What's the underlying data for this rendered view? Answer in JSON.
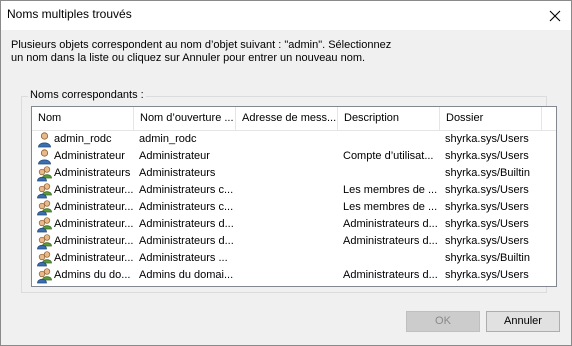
{
  "window": {
    "title": "Noms multiples trouvés"
  },
  "message": {
    "line1": "Plusieurs objets correspondent au nom d’objet suivant : \"admin\". Sélectionnez",
    "line2": "un nom dans la liste ou cliquez sur Annuler pour entrer un nouveau nom."
  },
  "matches": {
    "group_label": "Noms correspondants :",
    "columns": [
      "Nom",
      "Nom d’ouverture ...",
      "Adresse de mess...",
      "Description",
      "Dossier"
    ],
    "rows": [
      {
        "icon": "user-icon",
        "cells": [
          "admin_rodc",
          "admin_rodc",
          "",
          "",
          "shyrka.sys/Users"
        ]
      },
      {
        "icon": "user-icon",
        "cells": [
          "Administrateur",
          "Administrateur",
          "",
          "Compte d’utilisat...",
          "shyrka.sys/Users"
        ]
      },
      {
        "icon": "group-icon",
        "cells": [
          "Administrateurs",
          "Administrateurs",
          "",
          "",
          "shyrka.sys/Builtin"
        ]
      },
      {
        "icon": "group-icon",
        "cells": [
          "Administrateur...",
          "Administrateurs c...",
          "",
          "Les membres de ...",
          "shyrka.sys/Users"
        ]
      },
      {
        "icon": "group-icon",
        "cells": [
          "Administrateur...",
          "Administrateurs c...",
          "",
          "Les membres de ...",
          "shyrka.sys/Users"
        ]
      },
      {
        "icon": "group-icon",
        "cells": [
          "Administrateur...",
          "Administrateurs d...",
          "",
          "Administrateurs d...",
          "shyrka.sys/Users"
        ]
      },
      {
        "icon": "group-icon",
        "cells": [
          "Administrateur...",
          "Administrateurs d...",
          "",
          "Administrateurs d...",
          "shyrka.sys/Users"
        ]
      },
      {
        "icon": "group-icon",
        "cells": [
          "Administrateur...",
          "Administrateurs ...",
          "",
          "",
          "shyrka.sys/Builtin"
        ]
      },
      {
        "icon": "group-icon",
        "cells": [
          "Admins du do...",
          "Admins du domai...",
          "",
          "Administrateurs d...",
          "shyrka.sys/Users"
        ]
      }
    ]
  },
  "buttons": {
    "ok": "OK",
    "cancel": "Annuler"
  }
}
